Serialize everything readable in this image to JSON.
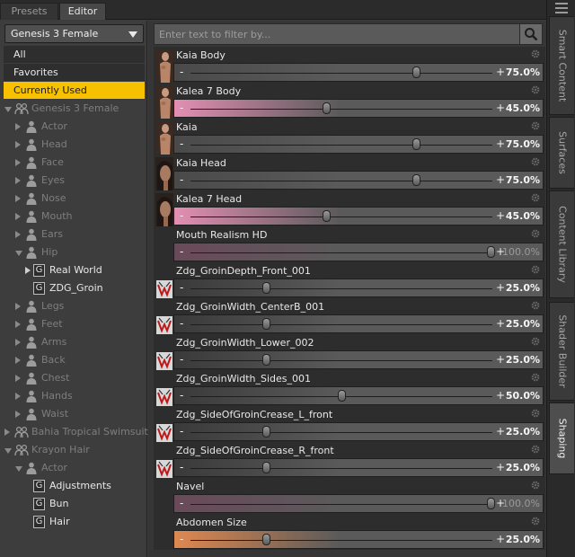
{
  "tabs": [
    "Presets",
    "Editor"
  ],
  "figure_selector": {
    "value": "Genesis 3 Female"
  },
  "categories": [
    {
      "label": "All",
      "selected": false
    },
    {
      "label": "Favorites",
      "selected": false
    },
    {
      "label": "Currently Used",
      "selected": true
    }
  ],
  "tree": [
    {
      "label": "Genesis 3 Female",
      "icon": "figure-icon",
      "expanded": true,
      "level": 0,
      "bright": false
    },
    {
      "label": "Actor",
      "icon": "person-icon",
      "expanded": false,
      "level": 1,
      "bright": false
    },
    {
      "label": "Head",
      "icon": "person-icon",
      "expanded": false,
      "level": 1,
      "bright": false
    },
    {
      "label": "Face",
      "icon": "person-icon",
      "expanded": false,
      "level": 1,
      "bright": false
    },
    {
      "label": "Eyes",
      "icon": "person-icon",
      "expanded": false,
      "level": 1,
      "bright": false
    },
    {
      "label": "Nose",
      "icon": "person-icon",
      "expanded": false,
      "level": 1,
      "bright": false
    },
    {
      "label": "Mouth",
      "icon": "person-icon",
      "expanded": false,
      "level": 1,
      "bright": false
    },
    {
      "label": "Ears",
      "icon": "person-icon",
      "expanded": false,
      "level": 1,
      "bright": false
    },
    {
      "label": "Hip",
      "icon": "person-icon",
      "expanded": true,
      "level": 1,
      "bright": false
    },
    {
      "label": "Real World",
      "icon": "group-icon",
      "expanded": false,
      "level": 2,
      "bright": true
    },
    {
      "label": "ZDG_Groin",
      "icon": "group-icon",
      "expanded": null,
      "level": 2,
      "bright": true
    },
    {
      "label": "Legs",
      "icon": "person-icon",
      "expanded": false,
      "level": 1,
      "bright": false
    },
    {
      "label": "Feet",
      "icon": "person-icon",
      "expanded": false,
      "level": 1,
      "bright": false
    },
    {
      "label": "Arms",
      "icon": "person-icon",
      "expanded": false,
      "level": 1,
      "bright": false
    },
    {
      "label": "Back",
      "icon": "person-icon",
      "expanded": false,
      "level": 1,
      "bright": false
    },
    {
      "label": "Chest",
      "icon": "person-icon",
      "expanded": false,
      "level": 1,
      "bright": false
    },
    {
      "label": "Hands",
      "icon": "person-icon",
      "expanded": false,
      "level": 1,
      "bright": false
    },
    {
      "label": "Waist",
      "icon": "person-icon",
      "expanded": false,
      "level": 1,
      "bright": false
    },
    {
      "label": "Bahia Tropical Swimsuit",
      "icon": "figure-icon",
      "expanded": false,
      "level": 0,
      "bright": false
    },
    {
      "label": "Krayon Hair",
      "icon": "figure-icon",
      "expanded": true,
      "level": 0,
      "bright": false
    },
    {
      "label": "Actor",
      "icon": "person-icon",
      "expanded": true,
      "level": 1,
      "bright": false
    },
    {
      "label": "Adjustments",
      "icon": "group-icon",
      "expanded": null,
      "level": 2,
      "bright": true
    },
    {
      "label": "Bun",
      "icon": "group-icon",
      "expanded": null,
      "level": 2,
      "bright": true
    },
    {
      "label": "Hair",
      "icon": "group-icon",
      "expanded": null,
      "level": 2,
      "bright": true
    }
  ],
  "filter": {
    "placeholder": "Enter text to filter by..."
  },
  "properties": [
    {
      "name": "Kaia Body",
      "value": 0.75,
      "value_text": "75.0%",
      "thumb": "body",
      "tint": "#4a4a4a"
    },
    {
      "name": "Kalea 7 Body",
      "value": 0.45,
      "value_text": "45.0%",
      "thumb": "body",
      "tint": "#e38fb3"
    },
    {
      "name": "Kaia",
      "value": 0.75,
      "value_text": "75.0%",
      "thumb": "body",
      "tint": "#4a4a4a"
    },
    {
      "name": "Kaia Head",
      "value": 0.75,
      "value_text": "75.0%",
      "thumb": "head",
      "tint": "#4a4a4a"
    },
    {
      "name": "Kalea 7 Head",
      "value": 0.45,
      "value_text": "45.0%",
      "thumb": "head",
      "tint": "#e38fb3"
    },
    {
      "name": "Mouth Realism HD",
      "value": 1.0,
      "value_text": "100.0%",
      "thumb": "none",
      "tint": "#6a4a5a",
      "dim": true
    },
    {
      "name": "Zdg_GroinDepth_Front_001",
      "value": 0.25,
      "value_text": "25.0%",
      "thumb": "groin",
      "tint": "#3a3a3a"
    },
    {
      "name": "Zdg_GroinWidth_CenterB_001",
      "value": 0.25,
      "value_text": "25.0%",
      "thumb": "groin",
      "tint": "#3a3a3a"
    },
    {
      "name": "Zdg_GroinWidth_Lower_002",
      "value": 0.25,
      "value_text": "25.0%",
      "thumb": "groin",
      "tint": "#3a3a3a"
    },
    {
      "name": "Zdg_GroinWidth_Sides_001",
      "value": 0.5,
      "value_text": "50.0%",
      "thumb": "groin",
      "tint": "#3a3a3a"
    },
    {
      "name": "Zdg_SideOfGroinCrease_L_front",
      "value": 0.25,
      "value_text": "25.0%",
      "thumb": "groin",
      "tint": "#3a3a3a"
    },
    {
      "name": "Zdg_SideOfGroinCrease_R_front",
      "value": 0.25,
      "value_text": "25.0%",
      "thumb": "groin",
      "tint": "#3a3a3a"
    },
    {
      "name": "Navel",
      "value": 1.0,
      "value_text": "100.0%",
      "thumb": "none",
      "tint": "#6a4a5a",
      "dim": true
    },
    {
      "name": "Abdomen Size",
      "value": 0.25,
      "value_text": "25.0%",
      "thumb": "none",
      "tint": "#e08850"
    }
  ],
  "right_tabs": [
    {
      "label": "Smart Content",
      "active": false
    },
    {
      "label": "Surfaces",
      "active": false
    },
    {
      "label": "Content Library",
      "active": false
    },
    {
      "label": "Shader Builder",
      "active": false
    },
    {
      "label": "Shaping",
      "active": true
    }
  ],
  "colors": {
    "accent": "#f7c100",
    "pink": "#e38fb3",
    "orange": "#e08850"
  }
}
